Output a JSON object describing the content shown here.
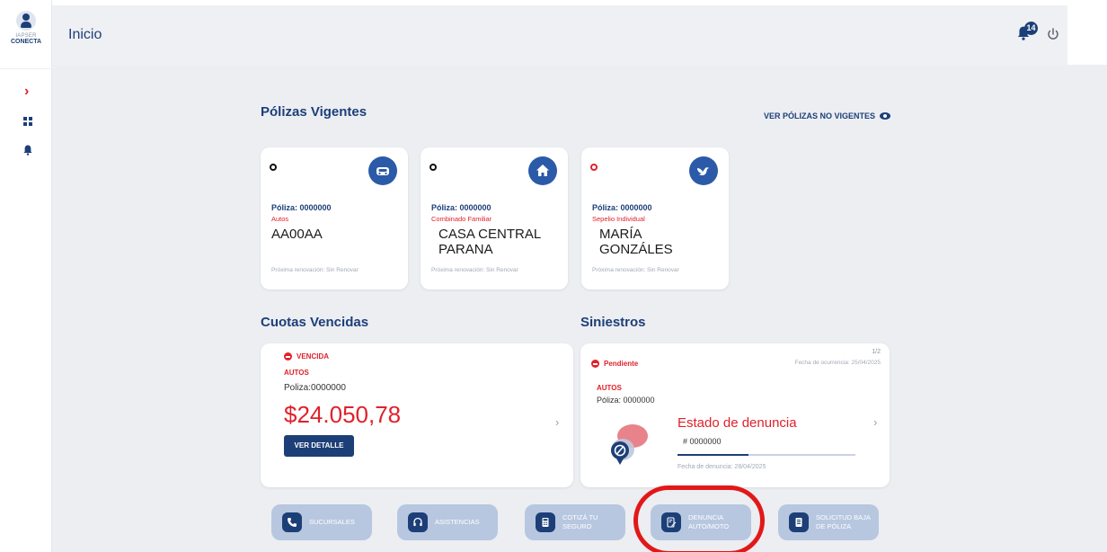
{
  "logo": {
    "line1": "IAPSER",
    "line2": "CONECTA"
  },
  "header": {
    "title": "Inicio",
    "notification_count": "14"
  },
  "polizas": {
    "title": "Pólizas Vigentes",
    "ver_no_vigentes": "VER PÓLIZAS NO VIGENTES",
    "cards": [
      {
        "poliza": "Póliza: 0000000",
        "tipo": "Autos",
        "nombre": "AA00AA",
        "renovacion": "Próxima renovación: Sin Renovar",
        "icon": "car-icon",
        "status_color": "#111111"
      },
      {
        "poliza": "Póliza: 0000000",
        "tipo": "Combinado Familiar",
        "nombre": "CASA CENTRAL PARANA",
        "renovacion": "Próxima renovación: Sin Renovar",
        "icon": "home-icon",
        "status_color": "#111111"
      },
      {
        "poliza": "Póliza: 0000000",
        "tipo": "Sepelio Individual",
        "nombre": "MARÍA GONZÁLES",
        "renovacion": "Próxima renovación: Sin Renovar",
        "icon": "dove-icon",
        "status_color": "#e0212b"
      }
    ]
  },
  "cuotas": {
    "title": "Cuotas Vencidas",
    "status": "VENCIDA",
    "tipo": "AUTOS",
    "poliza": "Poliza:0000000",
    "amount": "$24.050,78",
    "button": "VER DETALLE"
  },
  "siniestros": {
    "title": "Siniestros",
    "pagination": "1/2",
    "status": "Pendiente",
    "fecha_ocurrencia": "Fecha de ocurrencia: 25/04/2025",
    "tipo": "AUTOS",
    "poliza": "Póliza: 0000000",
    "estado_title": "Estado de denuncia",
    "numero": "# 0000000",
    "fecha_denuncia": "Fecha de denuncia: 28/04/2025",
    "progress": 0.4
  },
  "actions": [
    {
      "line1": "SUCURSALES",
      "line2": "",
      "icon": "phone-icon"
    },
    {
      "line1": "ASISTENCIAS",
      "line2": "",
      "icon": "headset-icon"
    },
    {
      "line1": "COTIZÁ TU",
      "line2": "SEGURO",
      "icon": "calculator-icon"
    },
    {
      "line1": "DENUNCIA",
      "line2": "AUTO/MOTO",
      "icon": "edit-document-icon"
    },
    {
      "line1": "SOLICITUD BAJA",
      "line2": "DE PÓLIZA",
      "icon": "document-icon"
    }
  ],
  "colors": {
    "primary": "#1d3f78",
    "accent_red": "#e0212b",
    "action_bg": "#b8c7e0",
    "highlight": "#e21818"
  }
}
